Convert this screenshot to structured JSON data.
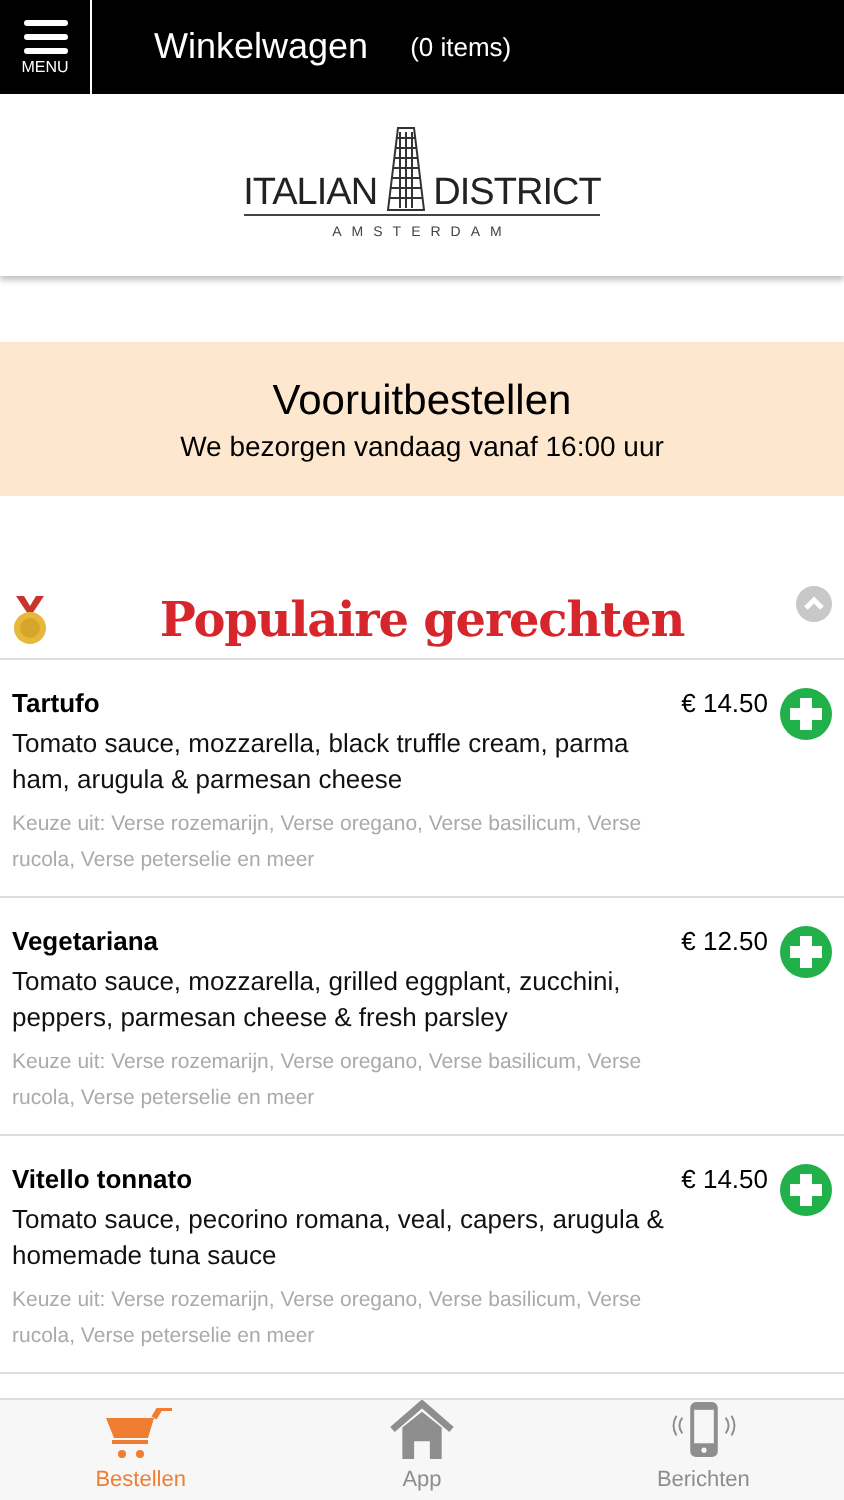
{
  "header": {
    "menu_label": "MENU",
    "title": "Winkelwagen",
    "cart_count": "(0 items)"
  },
  "logo": {
    "left": "ITALIAN",
    "right": "DISTRICT",
    "city": "AMSTERDAM"
  },
  "banner": {
    "title": "Vooruitbestellen",
    "subtitle": "We bezorgen vandaag vanaf 16:00 uur"
  },
  "section": {
    "title": "Populaire gerechten",
    "expanded": true
  },
  "items": [
    {
      "name": "Tartufo",
      "price": "€ 14.50",
      "description": "Tomato sauce, mozzarella, black truffle cream, parma ham, arugula & parmesan cheese",
      "options": "Keuze uit: Verse rozemarijn, Verse oregano, Verse basilicum, Verse rucola, Verse peterselie en meer"
    },
    {
      "name": "Vegetariana",
      "price": "€ 12.50",
      "description": "Tomato sauce, mozzarella, grilled eggplant, zucchini, peppers, parmesan cheese & fresh parsley",
      "options": "Keuze uit: Verse rozemarijn, Verse oregano, Verse basilicum, Verse rucola, Verse peterselie en meer"
    },
    {
      "name": "Vitello tonnato",
      "price": "€ 14.50",
      "description": "Tomato sauce, pecorino romana, veal, capers, arugula & homemade tuna sauce",
      "options": "Keuze uit: Verse rozemarijn, Verse oregano, Verse basilicum, Verse rucola, Verse peterselie en meer"
    }
  ],
  "tabs": [
    {
      "kind": "cart",
      "label": "Bestellen",
      "selected": true
    },
    {
      "kind": "home",
      "label": "App",
      "selected": false
    },
    {
      "kind": "phone",
      "label": "Berichten",
      "selected": false
    }
  ]
}
